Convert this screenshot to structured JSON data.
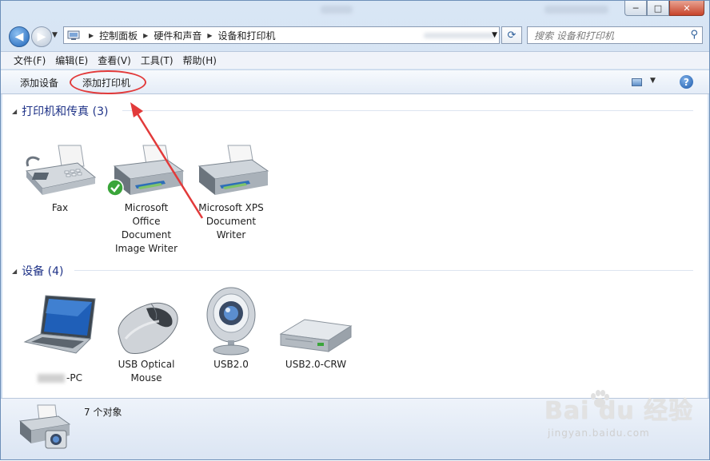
{
  "window": {
    "minimize_glyph": "─",
    "maximize_glyph": "□",
    "close_glyph": "✕"
  },
  "address": {
    "crumbs": [
      "控制面板",
      "硬件和声音",
      "设备和打印机"
    ]
  },
  "search": {
    "placeholder": "搜索 设备和打印机"
  },
  "menu": [
    "文件(F)",
    "编辑(E)",
    "查看(V)",
    "工具(T)",
    "帮助(H)"
  ],
  "commands": {
    "add_device": "添加设备",
    "add_printer": "添加打印机"
  },
  "help_glyph": "?",
  "groups": {
    "printers": {
      "title": "打印机和传真 (3)",
      "items": [
        {
          "label": "Fax",
          "icon": "fax-icon"
        },
        {
          "label": "Microsoft\nOffice\nDocument\nImage Writer",
          "icon": "printer-icon",
          "default": true
        },
        {
          "label": "Microsoft XPS\nDocument\nWriter",
          "icon": "printer-icon"
        }
      ]
    },
    "devices": {
      "title": "设备 (4)",
      "items": [
        {
          "label": "-PC",
          "icon": "laptop-icon"
        },
        {
          "label": "USB Optical\nMouse",
          "icon": "mouse-icon"
        },
        {
          "label": "USB2.0",
          "icon": "webcam-icon"
        },
        {
          "label": "USB2.0-CRW",
          "icon": "drive-icon"
        }
      ]
    }
  },
  "status": {
    "text": "7 个对象"
  },
  "watermark": {
    "logo": "Bai du 经验",
    "url": "jingyan.baidu.com"
  },
  "colors": {
    "annotation": "#e23a3a",
    "group_header": "#1e3287"
  }
}
